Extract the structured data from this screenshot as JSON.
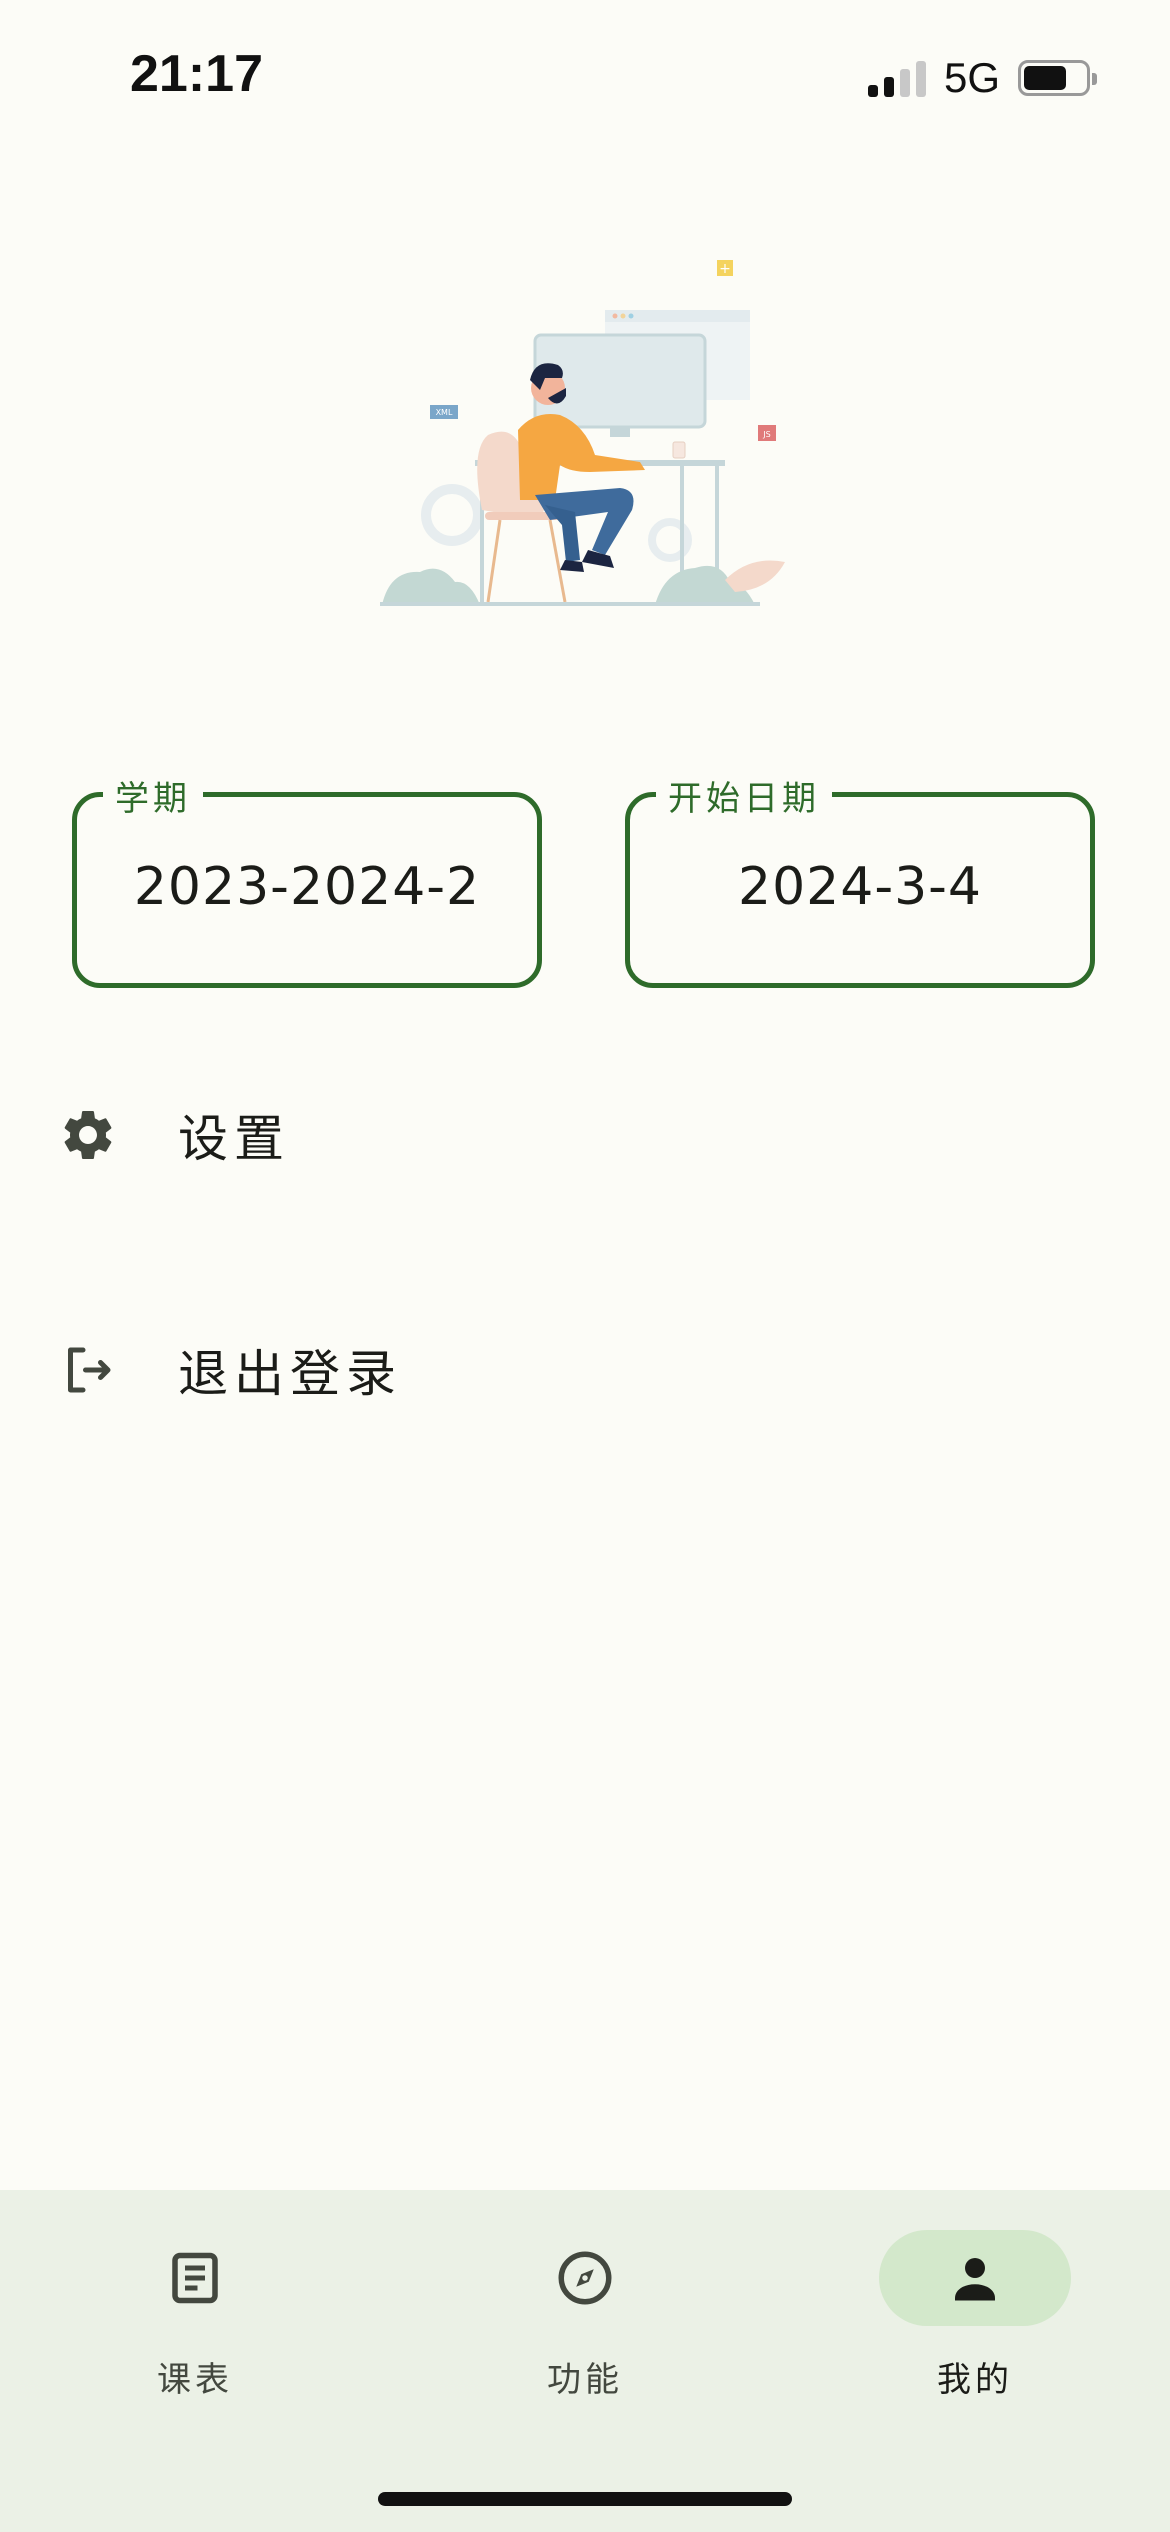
{
  "status_bar": {
    "time": "21:17",
    "network": "5G",
    "battery_level": 0.7
  },
  "info": {
    "semester": {
      "label": "学期",
      "value": "2023-2024-2"
    },
    "start_date": {
      "label": "开始日期",
      "value": "2024-3-4"
    }
  },
  "menu": {
    "settings": {
      "label": "设置",
      "icon": "gear-icon"
    },
    "logout": {
      "label": "退出登录",
      "icon": "logout-icon"
    }
  },
  "bottom_nav": {
    "items": [
      {
        "label": "课表",
        "icon": "schedule-icon",
        "active": false
      },
      {
        "label": "功能",
        "icon": "compass-icon",
        "active": false
      },
      {
        "label": "我的",
        "icon": "person-icon",
        "active": true
      }
    ]
  },
  "illustration": {
    "tags": [
      "XML",
      "JS"
    ]
  },
  "colors": {
    "primary": "#2e6b2a",
    "background": "#fcfcf7",
    "nav_background": "#ebf1e6",
    "nav_active_pill": "#d3e8cb"
  }
}
